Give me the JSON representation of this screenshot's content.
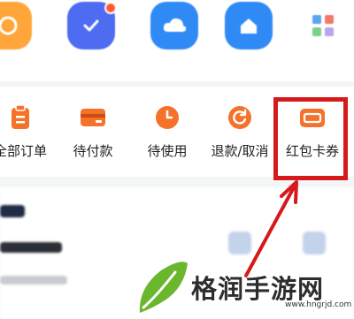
{
  "top_shortcuts": [
    {
      "label": "",
      "icon": "orange-circle-icon",
      "color": "#ffa53a"
    },
    {
      "label": "",
      "icon": "check-icon",
      "color": "#4d6cf2"
    },
    {
      "label": "",
      "icon": "cloud-icon",
      "color": "#2f8af5"
    },
    {
      "label": "",
      "icon": "home-icon",
      "color": "#2f8af5"
    },
    {
      "label": "",
      "icon": "grid-icon",
      "color": "#c9ccd2"
    }
  ],
  "orders": {
    "items": [
      {
        "label": "全部订单",
        "icon": "order-list-icon"
      },
      {
        "label": "待付款",
        "icon": "card-icon"
      },
      {
        "label": "待使用",
        "icon": "clock-icon"
      },
      {
        "label": "退款/取消",
        "icon": "refresh-icon"
      },
      {
        "label": "红包卡券",
        "icon": "wallet-icon"
      }
    ],
    "accent_color": "#f5722a"
  },
  "highlight": {
    "color": "#d6191b",
    "target": "红包卡券"
  },
  "watermark": {
    "text": "格润手游网",
    "url": "www.hngrjd.com"
  }
}
